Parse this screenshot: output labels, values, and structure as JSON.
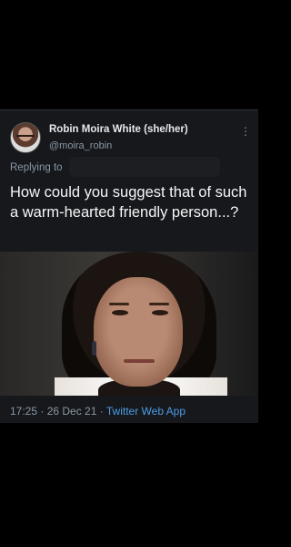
{
  "tweet": {
    "author_name": "Robin Moira White (she/her)",
    "author_handle": "@moira_robin",
    "more_glyph": "⋮",
    "replying_label": "Replying to",
    "text": "How could you suggest that of such a warm-hearted friendly person...?",
    "time": "17:25",
    "separator": " · ",
    "date": "26 Dec 21",
    "client": "Twitter Web App"
  },
  "colors": {
    "background": "#000000",
    "card": "#16181c",
    "secondary_text": "#8b98a5",
    "link": "#4d9ce6"
  }
}
